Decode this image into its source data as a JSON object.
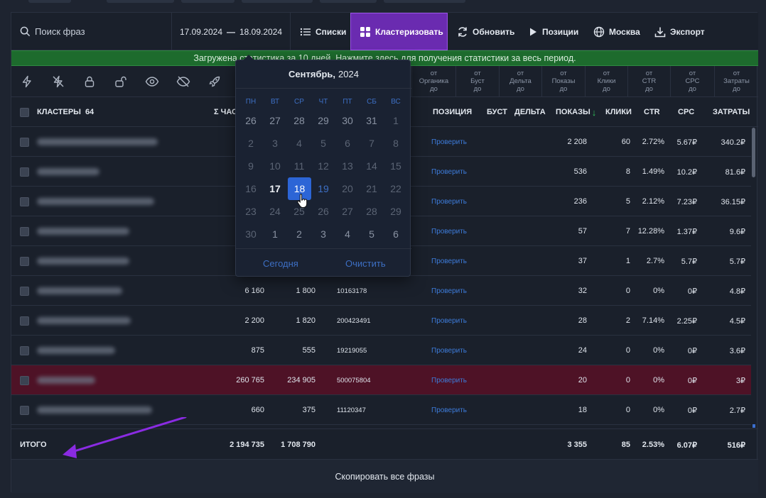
{
  "toolbar": {
    "search_placeholder": "Поиск фраз",
    "date_from": "17.09.2024",
    "date_sep": "—",
    "date_to": "18.09.2024",
    "lists_label": "Списки",
    "cluster_label": "Кластеризовать",
    "refresh_label": "Обновить",
    "positions_label": "Позиции",
    "region_label": "Москва",
    "export_label": "Экспорт"
  },
  "banner": {
    "text": "Загружена статистика за 10 дней. Нажмите здесь для получения статистики за весь период."
  },
  "filters": [
    {
      "top": "от",
      "mid": "Органика",
      "bot": "до"
    },
    {
      "top": "от",
      "mid": "Буст",
      "bot": "до"
    },
    {
      "top": "от",
      "mid": "Дельта",
      "bot": "до"
    },
    {
      "top": "от",
      "mid": "Показы",
      "bot": "до"
    },
    {
      "top": "от",
      "mid": "Клики",
      "bot": "до"
    },
    {
      "top": "от",
      "mid": "CTR",
      "bot": "до"
    },
    {
      "top": "от",
      "mid": "CPC",
      "bot": "до"
    },
    {
      "top": "от",
      "mid": "Затраты",
      "bot": "до"
    }
  ],
  "table": {
    "headers": {
      "clusters": "КЛАСТЕРЫ",
      "clusters_count": "64",
      "freq": "Σ ЧАСТ",
      "position": "ПОЗИЦИЯ",
      "boost": "БУСТ",
      "delta": "ДЕЛЬТА",
      "shows": "ПОКАЗЫ",
      "sort_arrow": "↓",
      "clicks": "КЛИКИ",
      "ctr": "CTR",
      "cpc": "CPC",
      "cost": "ЗАТРАТЫ"
    },
    "check_label": "Проверить",
    "rows": [
      {
        "f1": "",
        "f2": "",
        "f3": "",
        "shows": "2 208",
        "clicks": "60",
        "ctr": "2.72%",
        "cpc": "5.67₽",
        "cost": "340.2₽"
      },
      {
        "f1": "",
        "f2": "",
        "f3": "",
        "shows": "536",
        "clicks": "8",
        "ctr": "1.49%",
        "cpc": "10.2₽",
        "cost": "81.6₽"
      },
      {
        "f1": "",
        "f2": "",
        "f3": "",
        "shows": "236",
        "clicks": "5",
        "ctr": "2.12%",
        "cpc": "7.23₽",
        "cost": "36.15₽"
      },
      {
        "f1": "",
        "f2": "",
        "f3": "",
        "shows": "57",
        "clicks": "7",
        "ctr": "12.28%",
        "cpc": "1.37₽",
        "cost": "9.6₽"
      },
      {
        "f1": "",
        "f2": "",
        "f3": "",
        "shows": "37",
        "clicks": "1",
        "ctr": "2.7%",
        "cpc": "5.7₽",
        "cost": "5.7₽"
      },
      {
        "f1": "6 160",
        "f2": "1 800",
        "f3": "10163178",
        "shows": "32",
        "clicks": "0",
        "ctr": "0%",
        "cpc": "0₽",
        "cost": "4.8₽"
      },
      {
        "f1": "2 200",
        "f2": "1 820",
        "f3": "200423491",
        "shows": "28",
        "clicks": "2",
        "ctr": "7.14%",
        "cpc": "2.25₽",
        "cost": "4.5₽"
      },
      {
        "f1": "875",
        "f2": "555",
        "f3": "19219055",
        "shows": "24",
        "clicks": "0",
        "ctr": "0%",
        "cpc": "0₽",
        "cost": "3.6₽"
      },
      {
        "f1": "260 765",
        "f2": "234 905",
        "f3": "500075804",
        "shows": "20",
        "clicks": "0",
        "ctr": "0%",
        "cpc": "0₽",
        "cost": "3₽"
      },
      {
        "f1": "660",
        "f2": "375",
        "f3": "11120347",
        "shows": "18",
        "clicks": "0",
        "ctr": "0%",
        "cpc": "0₽",
        "cost": "2.7₽"
      }
    ],
    "total": {
      "label": "ИТОГО",
      "f1": "2 194 735",
      "f2": "1 708 790",
      "shows": "3 355",
      "clicks": "85",
      "ctr": "2.53%",
      "cpc": "6.07₽",
      "cost": "516₽"
    },
    "copy_all_label": "Скопировать все фразы"
  },
  "calendar": {
    "month": "Сентябрь,",
    "year": "2024",
    "weekdays": [
      "ПН",
      "ВТ",
      "СР",
      "ЧТ",
      "ПТ",
      "СБ",
      "ВС"
    ],
    "weeks": [
      [
        "26",
        "27",
        "28",
        "29",
        "30",
        "31",
        "1"
      ],
      [
        "2",
        "3",
        "4",
        "5",
        "6",
        "7",
        "8"
      ],
      [
        "9",
        "10",
        "11",
        "12",
        "13",
        "14",
        "15"
      ],
      [
        "16",
        "17",
        "18",
        "19",
        "20",
        "21",
        "22"
      ],
      [
        "23",
        "24",
        "25",
        "26",
        "27",
        "28",
        "29"
      ],
      [
        "30",
        "1",
        "2",
        "3",
        "4",
        "5",
        "6"
      ]
    ],
    "today_button": "Сегодня",
    "clear_button": "Очистить"
  },
  "colors": {
    "accent_purple": "#6a2bb0",
    "selected_day": "#2c65d6",
    "link_blue": "#3d6fc4",
    "banner_green": "#1d6b2d",
    "highlight_row": "#4e1226"
  }
}
